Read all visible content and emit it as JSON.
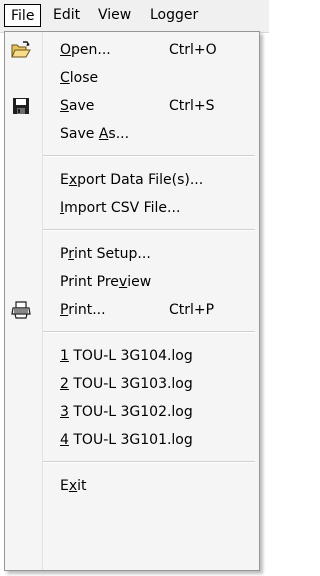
{
  "menubar": {
    "items": [
      {
        "label": "File",
        "active": true
      },
      {
        "label": "Edit"
      },
      {
        "label": "View"
      },
      {
        "label": "Logger"
      }
    ]
  },
  "file_menu": {
    "items": [
      {
        "id": "open",
        "label": "Open...",
        "mnemonic_index": 0,
        "shortcut": "Ctrl+O",
        "icon": "folder-open-icon"
      },
      {
        "id": "close",
        "label": "Close",
        "mnemonic_index": 0
      },
      {
        "id": "save",
        "label": "Save",
        "mnemonic_index": 0,
        "shortcut": "Ctrl+S",
        "icon": "floppy-disk-icon"
      },
      {
        "id": "save-as",
        "label": "Save As...",
        "mnemonic_index": 5
      },
      {
        "id": "export-data",
        "label": "Export Data File(s)...",
        "mnemonic_index": 1
      },
      {
        "id": "import-csv",
        "label": "Import CSV File...",
        "mnemonic_index": 0
      },
      {
        "id": "print-setup",
        "label": "Print Setup...",
        "mnemonic_index": 1
      },
      {
        "id": "print-preview",
        "label": "Print Preview",
        "mnemonic_index": 9
      },
      {
        "id": "print",
        "label": "Print...",
        "mnemonic_index": 0,
        "shortcut": "Ctrl+P",
        "icon": "printer-icon"
      },
      {
        "id": "recent-1",
        "label": "1 TOU-L 3G104.log",
        "mnemonic_index": 0
      },
      {
        "id": "recent-2",
        "label": "2 TOU-L 3G103.log",
        "mnemonic_index": 0
      },
      {
        "id": "recent-3",
        "label": "3 TOU-L 3G102.log",
        "mnemonic_index": 0
      },
      {
        "id": "recent-4",
        "label": "4 TOU-L 3G101.log",
        "mnemonic_index": 0
      },
      {
        "id": "exit",
        "label": "Exit",
        "mnemonic_index": 1
      }
    ]
  },
  "colors": {
    "menu_background": "#f5f5f5",
    "menu_border": "#979797",
    "separator": "#d0d0d0"
  }
}
